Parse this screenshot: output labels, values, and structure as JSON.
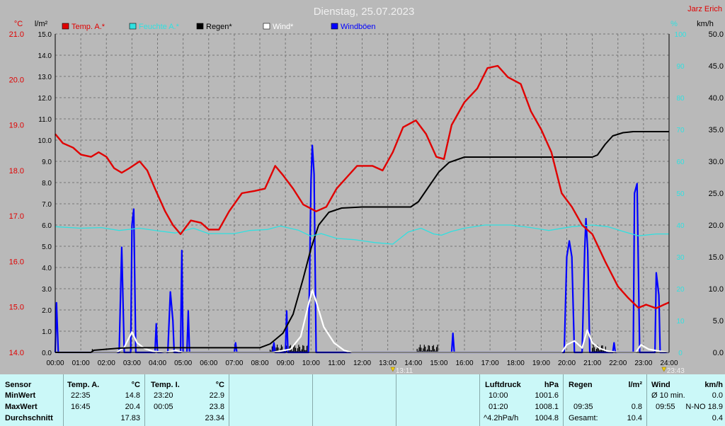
{
  "title": "Dienstag, 25.07.2023",
  "author": "Jarz Erich",
  "units": {
    "left_temp": "°C",
    "left_rain": "l/m²",
    "right_pct": "%",
    "right_speed": "km/h"
  },
  "legend": [
    {
      "label": "Temp. A.*",
      "color": "#e00000"
    },
    {
      "label": "Feuchte A.*",
      "color": "#30e0e0"
    },
    {
      "label": "Regen*",
      "color": "#000000"
    },
    {
      "label": "Wind*",
      "color": "#ffffff"
    },
    {
      "label": "Windböen",
      "color": "#0000ff"
    }
  ],
  "markers": [
    {
      "label": "13:11"
    },
    {
      "label": "23:43"
    }
  ],
  "chart_data": {
    "type": "line",
    "title": "Dienstag, 25.07.2023",
    "x_ticks": [
      "00:00",
      "01:00",
      "02:00",
      "03:00",
      "04:00",
      "05:00",
      "06:00",
      "07:00",
      "08:00",
      "09:00",
      "10:00",
      "11:00",
      "12:00",
      "13:00",
      "14:00",
      "15:00",
      "16:00",
      "17:00",
      "18:00",
      "19:00",
      "20:00",
      "21:00",
      "22:00",
      "23:00",
      "24:00"
    ],
    "x_range_hours": [
      0,
      24
    ],
    "axes": {
      "temp": {
        "label": "°C",
        "range": [
          14.0,
          21.0
        ],
        "ticks": [
          "14.0",
          "15.0",
          "16.0",
          "17.0",
          "18.0",
          "19.0",
          "20.0",
          "21.0"
        ]
      },
      "rain": {
        "label": "l/m²",
        "range": [
          0,
          15
        ],
        "ticks": [
          "0.0",
          "1.0",
          "2.0",
          "3.0",
          "4.0",
          "5.0",
          "6.0",
          "7.0",
          "8.0",
          "9.0",
          "10.0",
          "11.0",
          "12.0",
          "13.0",
          "14.0",
          "15.0"
        ]
      },
      "humidity": {
        "label": "%",
        "range": [
          0,
          100
        ],
        "ticks": [
          "0",
          "10",
          "20",
          "30",
          "40",
          "50",
          "60",
          "70",
          "80",
          "90",
          "100"
        ]
      },
      "wind": {
        "label": "km/h",
        "range": [
          0,
          50
        ],
        "ticks": [
          "0.0",
          "5.0",
          "10.0",
          "15.0",
          "20.0",
          "25.0",
          "30.0",
          "35.0",
          "40.0",
          "45.0",
          "50.0"
        ]
      }
    },
    "grid": true,
    "series": [
      {
        "name": "Temp. A.*",
        "axis": "temp",
        "color": "#e00000",
        "points": [
          [
            0,
            18.8
          ],
          [
            0.3,
            18.6
          ],
          [
            0.7,
            18.5
          ],
          [
            1,
            18.35
          ],
          [
            1.4,
            18.3
          ],
          [
            1.7,
            18.4
          ],
          [
            2,
            18.3
          ],
          [
            2.3,
            18.05
          ],
          [
            2.6,
            17.95
          ],
          [
            2.9,
            18.05
          ],
          [
            3.3,
            18.2
          ],
          [
            3.6,
            18.0
          ],
          [
            3.9,
            17.6
          ],
          [
            4.3,
            17.1
          ],
          [
            4.6,
            16.8
          ],
          [
            4.9,
            16.6
          ],
          [
            5.3,
            16.9
          ],
          [
            5.7,
            16.85
          ],
          [
            6.0,
            16.7
          ],
          [
            6.4,
            16.7
          ],
          [
            6.8,
            17.1
          ],
          [
            7.3,
            17.5
          ],
          [
            7.8,
            17.55
          ],
          [
            8.2,
            17.6
          ],
          [
            8.6,
            18.1
          ],
          [
            8.9,
            17.9
          ],
          [
            9.3,
            17.6
          ],
          [
            9.7,
            17.25
          ],
          [
            10.2,
            17.1
          ],
          [
            10.6,
            17.2
          ],
          [
            11.0,
            17.6
          ],
          [
            11.4,
            17.85
          ],
          [
            11.8,
            18.1
          ],
          [
            12.4,
            18.1
          ],
          [
            12.8,
            18.0
          ],
          [
            13.2,
            18.4
          ],
          [
            13.6,
            18.95
          ],
          [
            14.1,
            19.1
          ],
          [
            14.5,
            18.8
          ],
          [
            14.9,
            18.3
          ],
          [
            15.2,
            18.25
          ],
          [
            15.5,
            19.0
          ],
          [
            16.0,
            19.5
          ],
          [
            16.5,
            19.8
          ],
          [
            16.9,
            20.25
          ],
          [
            17.3,
            20.3
          ],
          [
            17.7,
            20.05
          ],
          [
            18.2,
            19.9
          ],
          [
            18.6,
            19.3
          ],
          [
            19.0,
            18.9
          ],
          [
            19.4,
            18.4
          ],
          [
            19.8,
            17.5
          ],
          [
            20.2,
            17.2
          ],
          [
            20.6,
            16.8
          ],
          [
            21.0,
            16.6
          ],
          [
            21.5,
            16.0
          ],
          [
            22.0,
            15.45
          ],
          [
            22.4,
            15.2
          ],
          [
            22.8,
            14.98
          ],
          [
            23.1,
            15.05
          ],
          [
            23.5,
            14.97
          ],
          [
            23.8,
            15.05
          ],
          [
            24.0,
            15.1
          ]
        ]
      },
      {
        "name": "Feuchte A.*",
        "axis": "humidity",
        "color": "#30e0e0",
        "points": [
          [
            0,
            39.5
          ],
          [
            1,
            39
          ],
          [
            1.8,
            39.2
          ],
          [
            2.5,
            38.3
          ],
          [
            3.3,
            39
          ],
          [
            4,
            38.2
          ],
          [
            4.7,
            37.5
          ],
          [
            5.4,
            39
          ],
          [
            6,
            37.3
          ],
          [
            7,
            37.3
          ],
          [
            7.6,
            38.3
          ],
          [
            8.3,
            38.6
          ],
          [
            8.8,
            39.7
          ],
          [
            9.5,
            38.4
          ],
          [
            10,
            36.5
          ],
          [
            10.4,
            37.3
          ],
          [
            11,
            35.8
          ],
          [
            11.7,
            35.4
          ],
          [
            12.5,
            34.5
          ],
          [
            13.2,
            34
          ],
          [
            13.8,
            37.8
          ],
          [
            14.3,
            39
          ],
          [
            14.8,
            37.2
          ],
          [
            15.1,
            36.8
          ],
          [
            15.5,
            38
          ],
          [
            16,
            39
          ],
          [
            16.8,
            40
          ],
          [
            17.8,
            40
          ],
          [
            18.5,
            39.3
          ],
          [
            19.3,
            38.3
          ],
          [
            20.2,
            39.5
          ],
          [
            21,
            40
          ],
          [
            21.6,
            39.5
          ],
          [
            22.2,
            38
          ],
          [
            22.8,
            36.6
          ],
          [
            23.5,
            37.2
          ],
          [
            24,
            37.2
          ]
        ]
      },
      {
        "name": "Regen*",
        "axis": "rain",
        "color": "#000000",
        "points": [
          [
            0,
            0
          ],
          [
            1.4,
            0
          ],
          [
            1.5,
            0.1
          ],
          [
            2,
            0.15
          ],
          [
            2.5,
            0.2
          ],
          [
            3,
            0.22
          ],
          [
            4,
            0.22
          ],
          [
            6,
            0.22
          ],
          [
            8,
            0.22
          ],
          [
            8.4,
            0.4
          ],
          [
            8.9,
            0.9
          ],
          [
            9.3,
            1.8
          ],
          [
            9.7,
            3.5
          ],
          [
            10.0,
            4.9
          ],
          [
            10.3,
            6.0
          ],
          [
            10.7,
            6.6
          ],
          [
            11.2,
            6.8
          ],
          [
            12,
            6.85
          ],
          [
            13,
            6.85
          ],
          [
            13.9,
            6.85
          ],
          [
            14.2,
            7.1
          ],
          [
            14.6,
            7.8
          ],
          [
            15.0,
            8.5
          ],
          [
            15.4,
            8.95
          ],
          [
            16,
            9.2
          ],
          [
            17,
            9.2
          ],
          [
            18,
            9.2
          ],
          [
            19,
            9.2
          ],
          [
            20,
            9.2
          ],
          [
            21,
            9.2
          ],
          [
            21.2,
            9.3
          ],
          [
            21.5,
            9.8
          ],
          [
            21.8,
            10.2
          ],
          [
            22.2,
            10.35
          ],
          [
            22.6,
            10.4
          ],
          [
            24,
            10.4
          ]
        ]
      },
      {
        "name": "Wind*",
        "axis": "wind",
        "color": "#ffffff",
        "points": [
          [
            0,
            0
          ],
          [
            2.4,
            0
          ],
          [
            2.7,
            0.8
          ],
          [
            3.0,
            3.2
          ],
          [
            3.2,
            1.5
          ],
          [
            3.5,
            0.6
          ],
          [
            3.8,
            0.2
          ],
          [
            4.3,
            0
          ],
          [
            4.7,
            0.3
          ],
          [
            5,
            0
          ],
          [
            8.5,
            0
          ],
          [
            9.2,
            0.5
          ],
          [
            9.6,
            2.5
          ],
          [
            9.9,
            7.5
          ],
          [
            10.05,
            9.8
          ],
          [
            10.2,
            8
          ],
          [
            10.5,
            4
          ],
          [
            10.9,
            1.5
          ],
          [
            11.3,
            0.3
          ],
          [
            11.6,
            0
          ],
          [
            19.8,
            0
          ],
          [
            20.0,
            1.2
          ],
          [
            20.3,
            1.8
          ],
          [
            20.6,
            0.7
          ],
          [
            20.8,
            3.5
          ],
          [
            21.0,
            1.5
          ],
          [
            21.3,
            0.6
          ],
          [
            21.6,
            0.2
          ],
          [
            22,
            0
          ],
          [
            22.7,
            0
          ],
          [
            22.9,
            1.2
          ],
          [
            23.2,
            0.5
          ],
          [
            23.6,
            0.2
          ],
          [
            24,
            0
          ]
        ]
      },
      {
        "name": "Windböen",
        "axis": "wind",
        "color": "#0000ff",
        "points": [
          [
            0,
            0
          ],
          [
            0.05,
            7.8
          ],
          [
            0.12,
            0
          ],
          [
            2.5,
            0
          ],
          [
            2.6,
            16.5
          ],
          [
            2.7,
            0
          ],
          [
            2.95,
            0
          ],
          [
            3.0,
            20
          ],
          [
            3.07,
            22.5
          ],
          [
            3.15,
            0
          ],
          [
            3.9,
            0
          ],
          [
            3.95,
            4.5
          ],
          [
            4.0,
            0
          ],
          [
            4.4,
            0
          ],
          [
            4.5,
            9.5
          ],
          [
            4.6,
            5
          ],
          [
            4.65,
            0
          ],
          [
            4.9,
            0
          ],
          [
            4.95,
            16
          ],
          [
            5.0,
            0
          ],
          [
            5.15,
            0
          ],
          [
            5.2,
            6.5
          ],
          [
            5.25,
            0
          ],
          [
            7.0,
            0
          ],
          [
            7.05,
            1.5
          ],
          [
            7.1,
            0
          ],
          [
            8.5,
            0
          ],
          [
            8.55,
            1.5
          ],
          [
            8.6,
            0
          ],
          [
            9.0,
            0
          ],
          [
            9.05,
            6.5
          ],
          [
            9.1,
            0
          ],
          [
            9.9,
            0
          ],
          [
            10.0,
            27
          ],
          [
            10.05,
            32.5
          ],
          [
            10.12,
            28
          ],
          [
            10.2,
            0
          ],
          [
            15.5,
            0
          ],
          [
            15.55,
            3
          ],
          [
            15.6,
            0
          ],
          [
            19.9,
            0
          ],
          [
            20.0,
            15
          ],
          [
            20.1,
            17.5
          ],
          [
            20.2,
            15
          ],
          [
            20.3,
            0
          ],
          [
            20.6,
            0
          ],
          [
            20.7,
            16
          ],
          [
            20.75,
            21
          ],
          [
            20.82,
            16
          ],
          [
            20.9,
            0
          ],
          [
            21.8,
            0
          ],
          [
            21.85,
            1.5
          ],
          [
            21.9,
            0
          ],
          [
            22.6,
            0
          ],
          [
            22.65,
            25
          ],
          [
            22.75,
            26.5
          ],
          [
            22.85,
            0
          ],
          [
            23.45,
            0
          ],
          [
            23.5,
            12.5
          ],
          [
            23.6,
            9
          ],
          [
            23.65,
            0
          ],
          [
            24,
            0
          ]
        ]
      }
    ],
    "rain_bars_hours": [
      [
        1.45,
        1.5
      ],
      [
        8.4,
        9.9
      ],
      [
        14.15,
        14.95
      ],
      [
        21.0,
        21.55
      ]
    ]
  },
  "stats": {
    "sensor": {
      "header": "Sensor",
      "rows": [
        "MinWert",
        "MaxWert",
        "Durchschnitt"
      ]
    },
    "temp_a": {
      "header": "Temp. A.",
      "unit": "°C",
      "rows": [
        [
          "22:35",
          "14.8"
        ],
        [
          "16:45",
          "20.4"
        ],
        [
          "",
          "17.83"
        ]
      ]
    },
    "temp_i": {
      "header": "Temp. I.",
      "unit": "°C",
      "rows": [
        [
          "23:20",
          "22.9"
        ],
        [
          "00:05",
          "23.8"
        ],
        [
          "",
          "23.34"
        ]
      ]
    },
    "luftdruck": {
      "header": "Luftdruck",
      "unit": "hPa",
      "rows": [
        [
          "10:00",
          "1001.6"
        ],
        [
          "01:20",
          "1008.1"
        ],
        [
          "^4.2hPa/h",
          "1004.8"
        ]
      ]
    },
    "regen": {
      "header": "Regen",
      "unit": "l/m²",
      "rows": [
        [
          "",
          ""
        ],
        [
          "09:35",
          "0.8"
        ],
        [
          "Gesamt:",
          "10.4"
        ]
      ]
    },
    "wind": {
      "header": "Wind",
      "unit": "km/h",
      "rows": [
        [
          "Ø 10 min.",
          "0.0"
        ],
        [
          "09:55",
          "N-NO 18.9"
        ],
        [
          "",
          "0.4"
        ]
      ]
    }
  }
}
